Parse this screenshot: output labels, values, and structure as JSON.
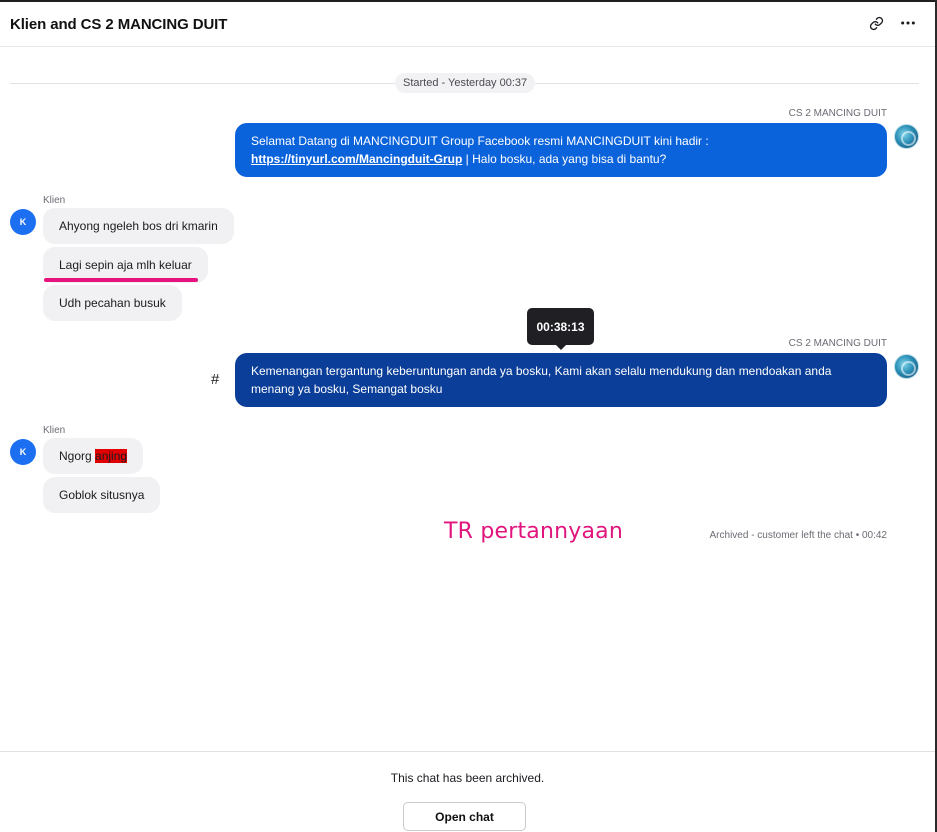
{
  "header": {
    "title": "Klien and CS 2 MANCING DUIT",
    "icons": [
      "link-icon",
      "more-icon"
    ]
  },
  "timeline": {
    "started": "Started - Yesterday 00:37",
    "archived": "Archived - customer left the chat • 00:42"
  },
  "messages": {
    "agent_name": "CS 2 MANCING DUIT",
    "client_name": "Klien",
    "client_initial": "K",
    "agent_1": {
      "line1": "Selamat Datang di MANCINGDUIT Group Facebook resmi MANCINGDUIT kini hadir :",
      "link": "https://tinyurl.com/Mancingduit-Grup",
      "after_link": " | Halo bosku, ada yang bisa di bantu?"
    },
    "client_group_1": [
      "Ahyong ngeleh bos dri kmarin",
      "Lagi sepin aja mlh keluar",
      "Udh pecahan busuk"
    ],
    "agent_2": "Kemenangan tergantung keberuntungan anda ya bosku, Kami akan selalu mendukung dan mendoakan anda menang ya bosku, Semangat bosku",
    "client_group_2": {
      "msg1_prefix": "Ngorg ",
      "msg1_highlight": "anjing",
      "msg2": "Goblok situsnya"
    }
  },
  "tooltip": {
    "time": "00:38:13"
  },
  "hash_symbol": "#",
  "annotation": "TR pertannyaan",
  "colors": {
    "agent_bubble": "#0b63dc",
    "agent_bubble_hover": "#0a3e98",
    "client_avatar": "#1c6ff0",
    "annotation": "#e0157d",
    "highlight": "#e30000"
  },
  "footer": {
    "text": "This chat has been archived.",
    "button": "Open chat"
  }
}
